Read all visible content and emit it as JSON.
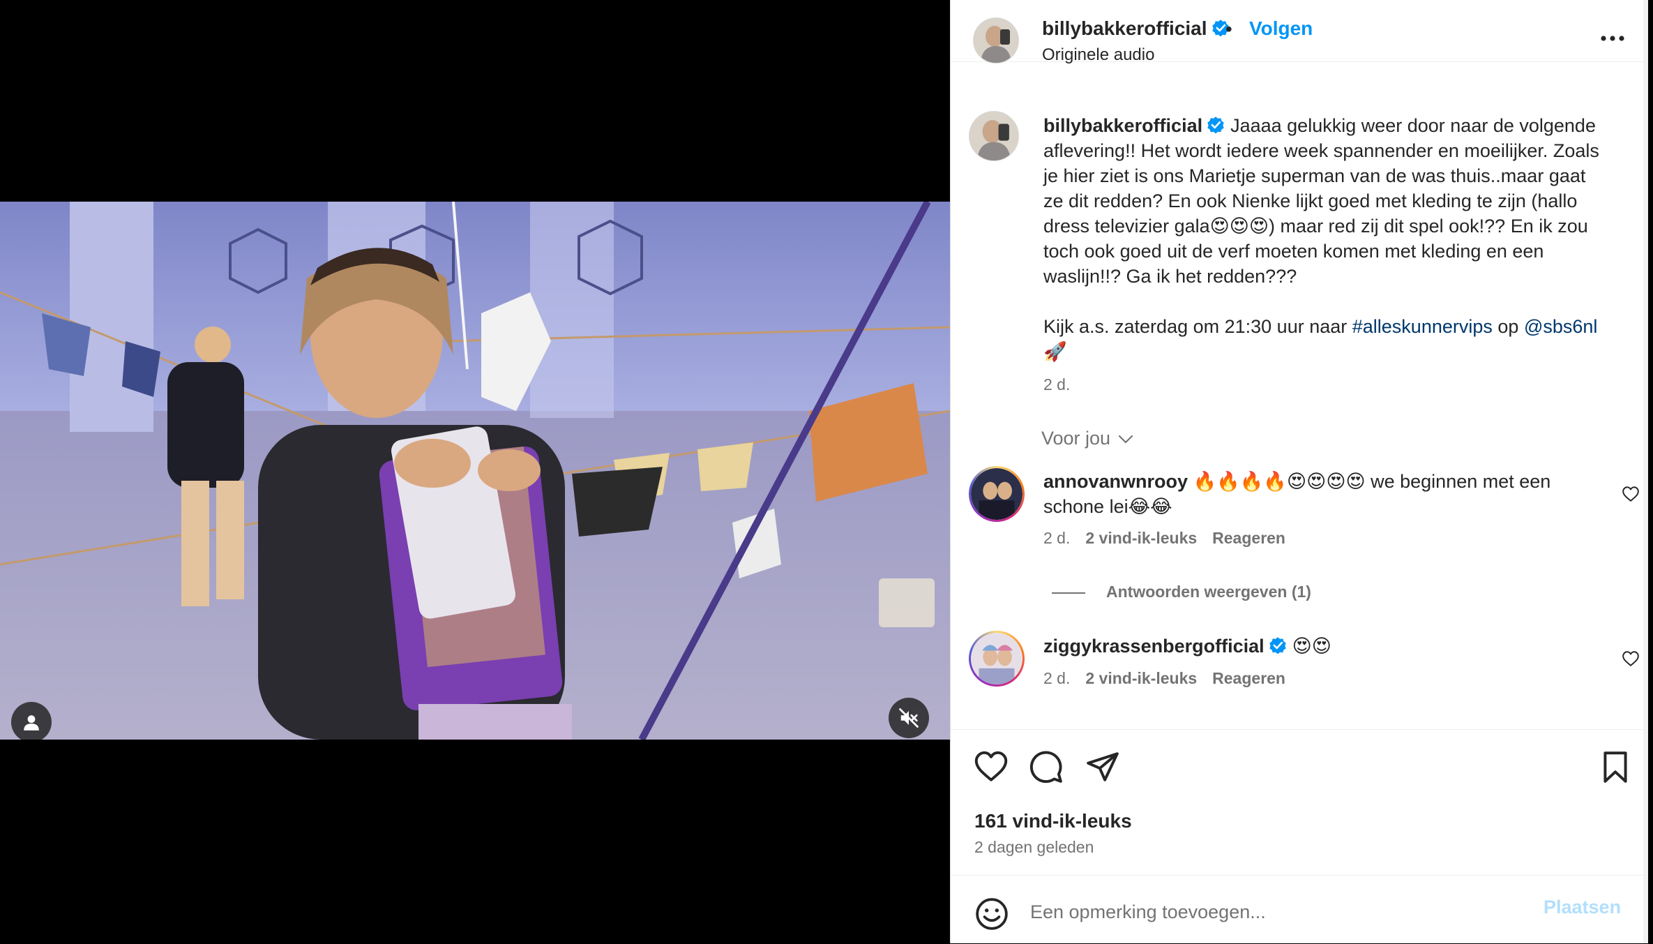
{
  "header": {
    "username": "billybakkerofficial",
    "dot": "•",
    "follow_label": "Volgen",
    "audio": "Originele audio"
  },
  "caption": {
    "username": "billybakkerofficial",
    "text": "Jaaaa gelukkig weer door naar de volgende aflevering!! Het wordt iedere week spannender en moeilijker. Zoals je hier ziet is ons Marietje superman van de was thuis..maar gaat ze dit redden? En ook Nienke lijkt goed met kleding te zijn (hallo dress televizier gala😍😍😍) maar red zij dit spel ook!?? En ik zou toch ook goed uit de verf moeten komen met kleding en een waslijn!!? Ga ik het redden???",
    "line2_prefix": "Kijk a.s. zaterdag om 21:30 uur naar",
    "hashtag": "#alleskunnervips",
    "op": "op",
    "mention": "@sbs6nl",
    "rocket": "🚀",
    "time": "2 d."
  },
  "for_you_label": "Voor jou",
  "comments": [
    {
      "username": "annovanwnrooy",
      "text": "🔥🔥🔥🔥😍😍😍😍 we beginnen met een schone lei😂😂",
      "time": "2 d.",
      "likes": "2 vind-ik-leuks",
      "reply_label": "Reageren"
    },
    {
      "username": "ziggykrassenbergofficial",
      "text": "😍😍",
      "time": "2 d.",
      "likes": "2 vind-ik-leuks",
      "reply_label": "Reageren"
    }
  ],
  "view_replies_label": "Antwoorden weergeven (1)",
  "actions": {
    "likes_count": "161 vind-ik-leuks",
    "date": "2 dagen geleden"
  },
  "comment_box": {
    "placeholder": "Een opmerking toevoegen...",
    "post_label": "Plaatsen"
  },
  "colors": {
    "accent": "#0095f6",
    "verified": "#0095f6",
    "link": "#00376b",
    "muted": "#737373"
  },
  "icons": [
    "verified-badge-icon",
    "more-options-icon",
    "user-tag-icon",
    "mute-icon",
    "heart-icon",
    "comment-icon",
    "share-icon",
    "bookmark-icon",
    "emoji-icon",
    "chevron-down-icon"
  ]
}
